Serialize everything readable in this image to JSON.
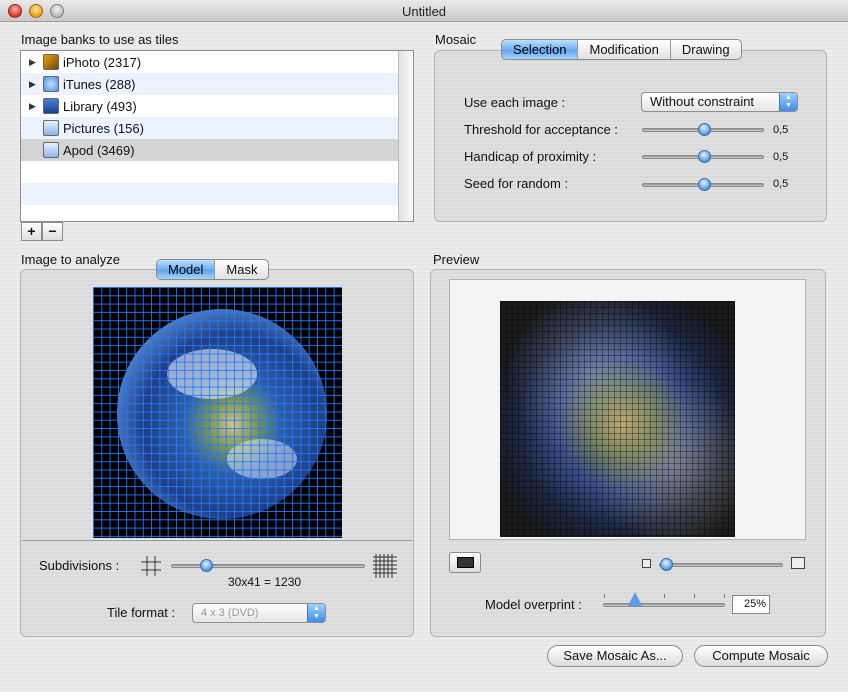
{
  "window": {
    "title": "Untitled"
  },
  "banks": {
    "label": "Image banks to use as tiles",
    "items": [
      {
        "label": "iPhoto (2317)",
        "icon": "iphoto-icon",
        "expandable": true
      },
      {
        "label": "iTunes (288)",
        "icon": "itunes-icon",
        "expandable": true
      },
      {
        "label": "Library (493)",
        "icon": "library-icon",
        "expandable": true
      },
      {
        "label": "Pictures (156)",
        "icon": "folder-icon",
        "expandable": false
      },
      {
        "label": "Apod (3469)",
        "icon": "folder-icon",
        "expandable": false,
        "selected": true
      }
    ],
    "add_label": "+",
    "remove_label": "−"
  },
  "mosaic": {
    "label": "Mosaic",
    "tabs": [
      "Selection",
      "Modification",
      "Drawing"
    ],
    "active_tab": "Selection",
    "use_each_image": {
      "label": "Use each image :",
      "value": "Without constraint"
    },
    "threshold": {
      "label": "Threshold for acceptance :",
      "value": "0,5"
    },
    "handicap": {
      "label": "Handicap of proximity :",
      "value": "0,5"
    },
    "seed": {
      "label": "Seed for random :",
      "value": "0,5"
    }
  },
  "analyze": {
    "label": "Image to analyze",
    "tabs": [
      "Model",
      "Mask"
    ],
    "active_tab": "Model",
    "subdivisions_label": "Subdivisions :",
    "subdivisions_value": "30x41 = 1230",
    "tile_format_label": "Tile format :",
    "tile_format_value": "4 x 3 (DVD)"
  },
  "preview": {
    "label": "Preview",
    "overprint_label": "Model overprint :",
    "overprint_value": "25%"
  },
  "buttons": {
    "save": "Save Mosaic As...",
    "compute": "Compute Mosaic"
  },
  "colors": {
    "accent": "#5aa2ec",
    "grid": "#2878ff"
  }
}
